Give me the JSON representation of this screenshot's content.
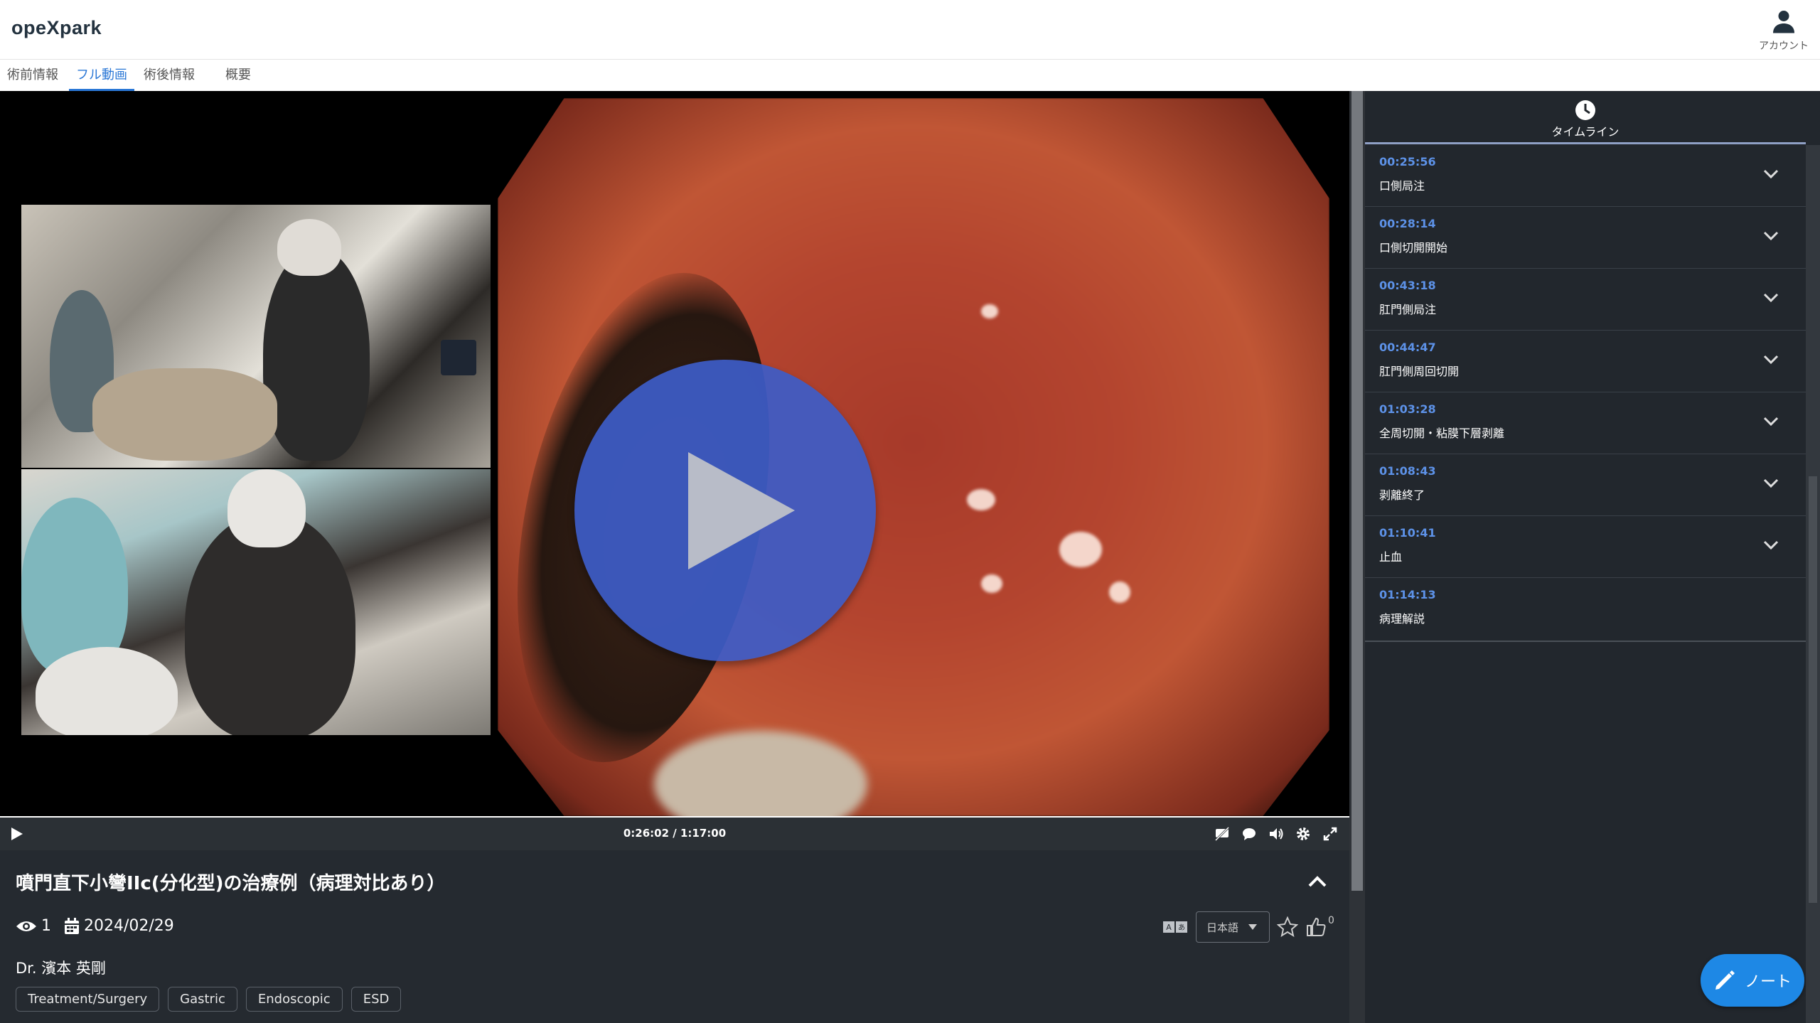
{
  "app": {
    "logo": "opeXpark"
  },
  "account": {
    "label": "アカウント",
    "icon": "person-icon"
  },
  "tabs": [
    {
      "label": "術前情報",
      "active": false
    },
    {
      "label": "フル動画",
      "active": true
    },
    {
      "label": "術後情報",
      "active": false
    },
    {
      "label": "概要",
      "active": false
    }
  ],
  "player": {
    "time": "0:26:02 / 1:17:00",
    "progress": 0.338
  },
  "video_info": {
    "title": "噴門直下小彎IIc(分化型)の治療例（病理対比あり）",
    "views": "1",
    "date": "2024/02/29",
    "doctor": "Dr. 濱本 英剛",
    "tags": [
      "Treatment/Surgery",
      "Gastric",
      "Endoscopic",
      "ESD"
    ],
    "language": "日本語",
    "likes": "0"
  },
  "timeline": {
    "title": "タイムライン",
    "items": [
      {
        "time": "00:25:56",
        "label": "口側局注"
      },
      {
        "time": "00:28:14",
        "label": "口側切開開始"
      },
      {
        "time": "00:43:18",
        "label": "肛門側局注"
      },
      {
        "time": "00:44:47",
        "label": "肛門側周回切開"
      },
      {
        "time": "01:03:28",
        "label": "全周切開・粘膜下層剥離"
      },
      {
        "time": "01:08:43",
        "label": "剥離終了"
      },
      {
        "time": "01:10:41",
        "label": "止血"
      },
      {
        "time": "01:14:13",
        "label": "病理解説"
      }
    ]
  },
  "note_button": {
    "label": "ノート"
  },
  "colors": {
    "accent": "#2a77d6",
    "timeline_time": "#5d92e8",
    "play_button": "#3d5cc8",
    "note": "#1e88e5"
  }
}
